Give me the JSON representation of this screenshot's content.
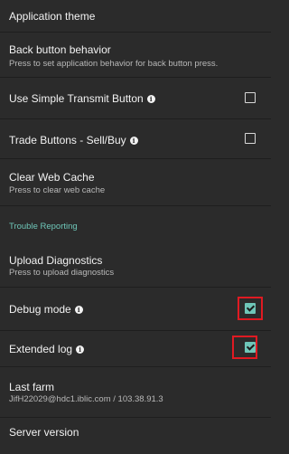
{
  "settings": {
    "application_theme": {
      "title": "Application theme"
    },
    "back_button": {
      "title": "Back button behavior",
      "subtitle": "Press to set application behavior for back button press."
    },
    "simple_transmit": {
      "title": "Use Simple Transmit Button",
      "checked": false
    },
    "trade_buttons": {
      "title": "Trade Buttons - Sell/Buy",
      "checked": false
    },
    "clear_cache": {
      "title": "Clear Web Cache",
      "subtitle": "Press to clear web cache"
    },
    "trouble_reporting_header": "Trouble Reporting",
    "upload_diagnostics": {
      "title": "Upload Diagnostics",
      "subtitle": "Press to upload diagnostics"
    },
    "debug_mode": {
      "title": "Debug mode",
      "checked": true
    },
    "extended_log": {
      "title": "Extended log",
      "checked": true
    },
    "last_farm": {
      "title": "Last farm",
      "subtitle": "JifH22029@hdc1.iblic.com / 103.38.91.3"
    },
    "partial_next": {
      "title": "Server version"
    }
  },
  "colors": {
    "background": "#2b2b2b",
    "accent": "#6ec6b8",
    "highlight": "#e01a22"
  }
}
